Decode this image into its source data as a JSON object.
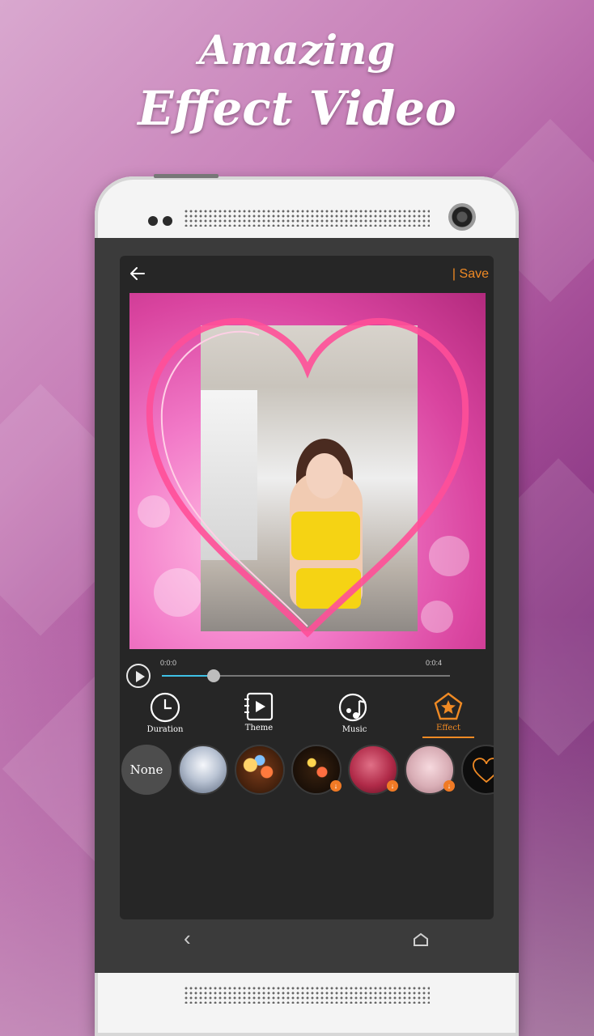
{
  "promo": {
    "line1": "Amazing",
    "line2": "Effect Video"
  },
  "editor": {
    "save_label": "| Save",
    "time_start": "0:0:0",
    "time_end": "0:0:4",
    "progress_fraction": 0.18
  },
  "tabs": [
    {
      "label": "Duration",
      "icon": "clock-icon"
    },
    {
      "label": "Theme",
      "icon": "theme-icon"
    },
    {
      "label": "Music",
      "icon": "music-icon"
    },
    {
      "label": "Effect",
      "icon": "pentagon-star-icon",
      "active": true
    }
  ],
  "effects": [
    {
      "label": "None",
      "downloadable": false
    },
    {
      "label": "",
      "downloadable": false,
      "theme": "snow-glitter"
    },
    {
      "label": "",
      "downloadable": false,
      "theme": "bokeh-lights"
    },
    {
      "label": "",
      "downloadable": true,
      "theme": "fireworks"
    },
    {
      "label": "",
      "downloadable": true,
      "theme": "red-hearts"
    },
    {
      "label": "",
      "downloadable": true,
      "theme": "pink-bokeh"
    },
    {
      "label": "",
      "downloadable": false,
      "theme": "neon-heart"
    }
  ],
  "colors": {
    "accent": "#f08a24",
    "progress": "#3fc1e6",
    "screen_bg": "#262626"
  }
}
